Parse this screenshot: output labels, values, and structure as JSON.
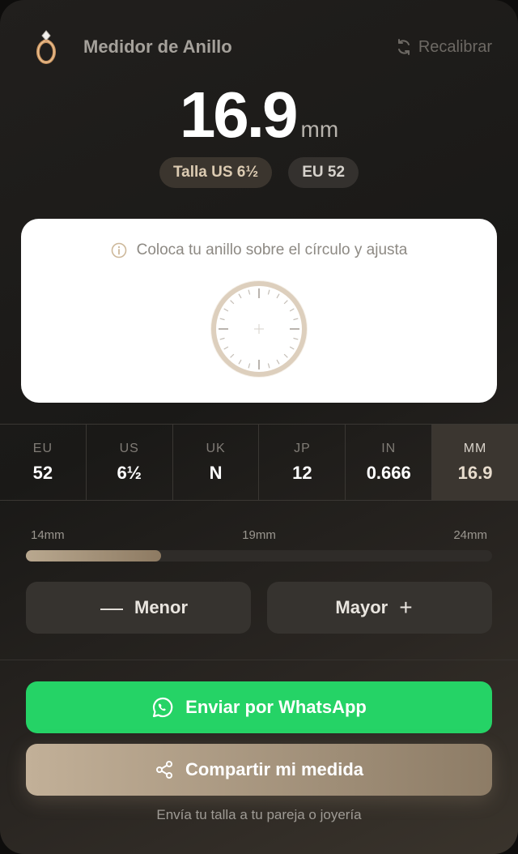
{
  "header": {
    "title": "Medidor de Anillo",
    "recalibrate_label": "Recalibrar"
  },
  "measurement": {
    "value": "16.9",
    "unit": "mm",
    "badge_us": "Talla US 6½",
    "badge_eu": "EU 52"
  },
  "calibration_panel": {
    "hint": "Coloca tu anillo sobre el círculo y ajusta"
  },
  "size_table": [
    {
      "label": "EU",
      "value": "52"
    },
    {
      "label": "US",
      "value": "6½"
    },
    {
      "label": "UK",
      "value": "N"
    },
    {
      "label": "JP",
      "value": "12"
    },
    {
      "label": "IN",
      "value": "0.666"
    },
    {
      "label": "MM",
      "value": "16.9"
    }
  ],
  "range": {
    "min_label": "14mm",
    "mid_label": "19mm",
    "max_label": "24mm",
    "fill_fraction": 0.29
  },
  "controls": {
    "smaller_label": "Menor",
    "larger_label": "Mayor"
  },
  "actions": {
    "whatsapp_label": "Enviar por WhatsApp",
    "share_label": "Compartir mi medida"
  },
  "footer": {
    "note": "Envía tu talla a tu pareja o joyería"
  },
  "colors": {
    "whatsapp": "#25d366",
    "accent": "#b9a88f",
    "background": "#1c1b19"
  }
}
